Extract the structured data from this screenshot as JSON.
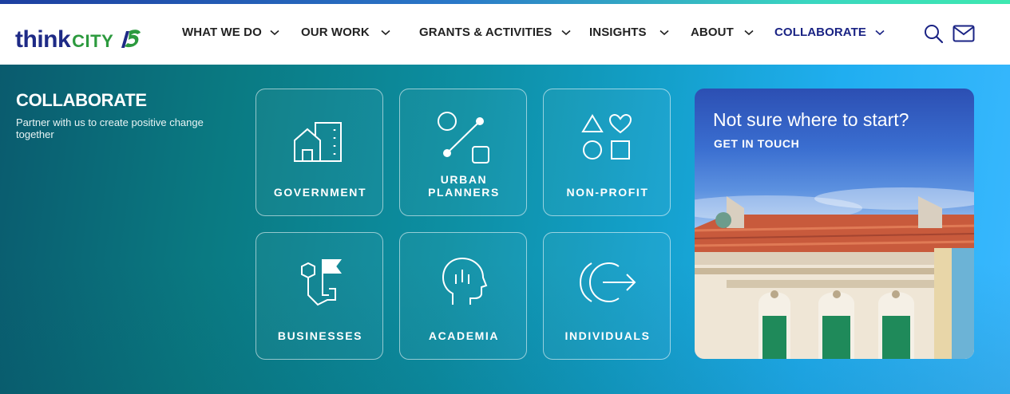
{
  "brand": {
    "name_part1": "think",
    "name_part2": "CITY",
    "mark": "15"
  },
  "nav": {
    "items": [
      {
        "label": "WHAT WE DO"
      },
      {
        "label": "OUR WORK"
      },
      {
        "label": "GRANTS & ACTIVITIES"
      },
      {
        "label": "INSIGHTS"
      },
      {
        "label": "ABOUT"
      },
      {
        "label": "COLLABORATE",
        "active": true
      }
    ],
    "icons": [
      "search-icon",
      "mail-icon"
    ]
  },
  "section": {
    "title": "COLLABORATE",
    "subtitle": "Partner with us to create positive change together"
  },
  "cards": [
    {
      "label_line1": "GOVERNMENT",
      "label_line2": "",
      "icon": "government-buildings-icon"
    },
    {
      "label_line1": "URBAN",
      "label_line2": "PLANNERS",
      "icon": "urban-planners-icon"
    },
    {
      "label_line1": "NON-PROFIT",
      "label_line2": "",
      "icon": "non-profit-shapes-icon"
    },
    {
      "label_line1": "BUSINESSES",
      "label_line2": "",
      "icon": "businesses-flag-icon"
    },
    {
      "label_line1": "ACADEMIA",
      "label_line2": "",
      "icon": "academia-head-icon"
    },
    {
      "label_line1": "INDIVIDUALS",
      "label_line2": "",
      "icon": "individuals-arrow-icon"
    }
  ],
  "promo": {
    "title": "Not sure where to start?",
    "cta": "GET IN TOUCH"
  },
  "colors": {
    "brand_navy": "#1e2a86",
    "brand_green": "#2c9a3e",
    "nav_active": "#1a2384",
    "panel_start": "#0a5b6e",
    "panel_end": "#3ab8ff"
  }
}
